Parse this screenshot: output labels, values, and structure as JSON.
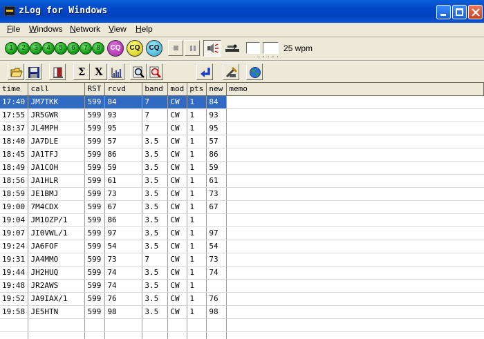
{
  "window": {
    "title": "zLog for Windows"
  },
  "menu": [
    {
      "accel": "F",
      "rest": "ile"
    },
    {
      "accel": "W",
      "rest": "indows"
    },
    {
      "accel": "N",
      "rest": "etwork"
    },
    {
      "accel": "V",
      "rest": "iew"
    },
    {
      "accel": "H",
      "rest": "elp"
    }
  ],
  "toolbar1": {
    "leds": [
      "1",
      "2",
      "3",
      "4",
      "5",
      "6",
      "7",
      "8"
    ],
    "cq_buttons": [
      "CQ",
      "CQ",
      "CQ"
    ],
    "wpm_label": "25 wpm",
    "led_color": "#18a018"
  },
  "toolbar2": {
    "sum_symbol": "Σ",
    "x_symbol": "X"
  },
  "grid": {
    "columns": [
      "time",
      "call",
      "RST",
      "rcvd",
      "band",
      "mod",
      "pts",
      "new",
      "memo"
    ],
    "rows": [
      [
        "17:40",
        "JM7TKK",
        "599",
        "84",
        "7",
        "CW",
        "1",
        "84",
        ""
      ],
      [
        "17:55",
        "JR5GWR",
        "599",
        "93",
        "7",
        "CW",
        "1",
        "93",
        ""
      ],
      [
        "18:37",
        "JL4MPH",
        "599",
        "95",
        "7",
        "CW",
        "1",
        "95",
        ""
      ],
      [
        "18:40",
        "JA7DLE",
        "599",
        "57",
        "3.5",
        "CW",
        "1",
        "57",
        ""
      ],
      [
        "18:45",
        "JA1TFJ",
        "599",
        "86",
        "3.5",
        "CW",
        "1",
        "86",
        ""
      ],
      [
        "18:49",
        "JA1COH",
        "599",
        "59",
        "3.5",
        "CW",
        "1",
        "59",
        ""
      ],
      [
        "18:56",
        "JA1HLR",
        "599",
        "61",
        "3.5",
        "CW",
        "1",
        "61",
        ""
      ],
      [
        "18:59",
        "JE1BMJ",
        "599",
        "73",
        "3.5",
        "CW",
        "1",
        "73",
        ""
      ],
      [
        "19:00",
        "7M4CDX",
        "599",
        "67",
        "3.5",
        "CW",
        "1",
        "67",
        ""
      ],
      [
        "19:04",
        "JM1OZP/1",
        "599",
        "86",
        "3.5",
        "CW",
        "1",
        "",
        ""
      ],
      [
        "19:07",
        "JI0VWL/1",
        "599",
        "97",
        "3.5",
        "CW",
        "1",
        "97",
        ""
      ],
      [
        "19:24",
        "JA6FOF",
        "599",
        "54",
        "3.5",
        "CW",
        "1",
        "54",
        ""
      ],
      [
        "19:31",
        "JA4MMO",
        "599",
        "73",
        "7",
        "CW",
        "1",
        "73",
        ""
      ],
      [
        "19:44",
        "JH2HUQ",
        "599",
        "74",
        "3.5",
        "CW",
        "1",
        "74",
        ""
      ],
      [
        "19:48",
        "JR2AWS",
        "599",
        "74",
        "3.5",
        "CW",
        "1",
        "",
        ""
      ],
      [
        "19:52",
        "JA9IAX/1",
        "599",
        "76",
        "3.5",
        "CW",
        "1",
        "76",
        ""
      ],
      [
        "19:58",
        "JE5HTN",
        "599",
        "98",
        "3.5",
        "CW",
        "1",
        "98",
        ""
      ]
    ],
    "selected_row": 0,
    "selection_color": "#316ac5"
  }
}
